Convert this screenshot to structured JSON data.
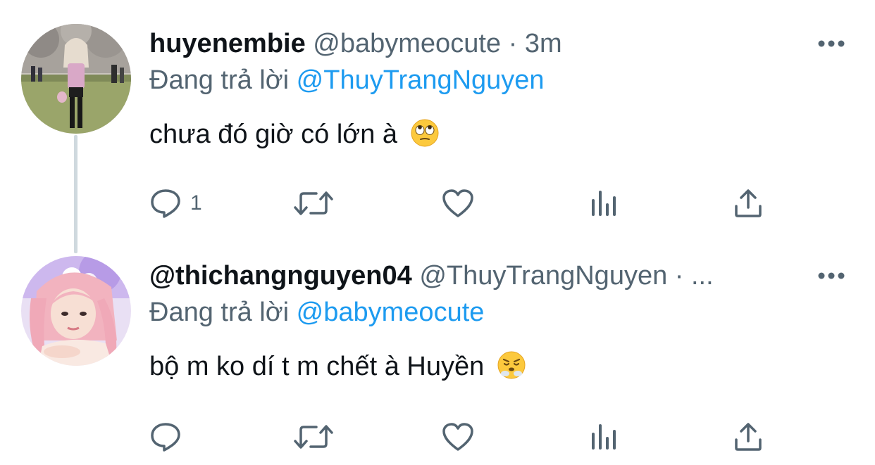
{
  "colors": {
    "name": "#0f1419",
    "secondary": "#536471",
    "mention": "#1d9bf0",
    "connector": "#cfd9de"
  },
  "tweets": [
    {
      "display_name": "huyenembie",
      "handle": "@babymeocute",
      "separator": "·",
      "time": "3m",
      "more_icon": "more-dots-icon",
      "replying_prefix": "Đang trả lời",
      "replying_to": "@ThuyTrangNguyen",
      "text": "chưa đó giờ có lớn à",
      "emoji": "face-with-rolling-eyes",
      "avatar": "avatar-photo-park",
      "actions": {
        "reply_count": "1",
        "retweet_count": "",
        "like_count": "",
        "views_count": ""
      }
    },
    {
      "display_name": "@thichangnguyen04",
      "handle": "@ThuyTrangNguyen",
      "separator": "·",
      "time": "...",
      "more_icon": "more-dots-icon",
      "replying_prefix": "Đang trả lời",
      "replying_to": "@babymeocute",
      "text": "bộ m ko dí t m chết à Huyền",
      "emoji": "face-with-steam-from-nose",
      "avatar": "avatar-photo-pink-hair",
      "actions": {
        "reply_count": "",
        "retweet_count": "",
        "like_count": "",
        "views_count": ""
      }
    }
  ]
}
